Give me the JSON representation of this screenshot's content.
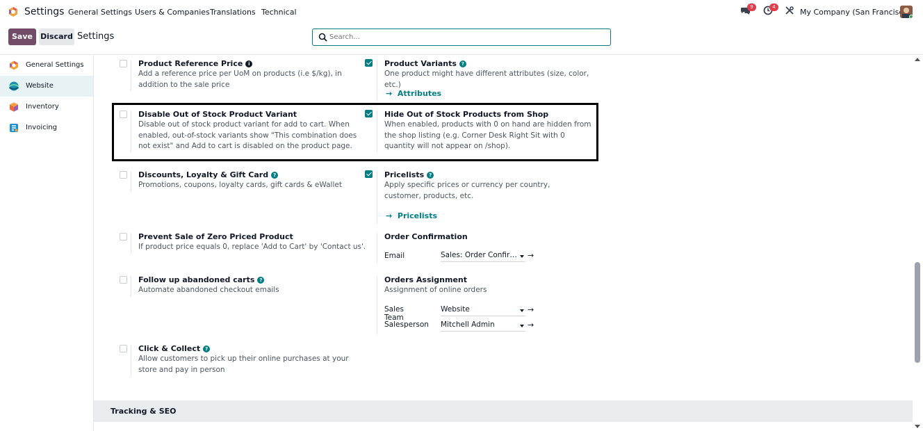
{
  "topbar": {
    "app_title": "Settings",
    "menu": [
      "General Settings",
      "Users & Companies",
      "Translations",
      "Technical"
    ],
    "messages_count": "9",
    "activities_count": "4",
    "company": "My Company (San Francisco)"
  },
  "controlbar": {
    "save_label": "Save",
    "discard_label": "Discard",
    "breadcrumb": "Settings",
    "search_placeholder": "Search..."
  },
  "sidebar": {
    "items": [
      {
        "label": "General Settings",
        "icon": "odoo-logo-icon",
        "active": false
      },
      {
        "label": "Website",
        "icon": "website-icon",
        "active": true
      },
      {
        "label": "Inventory",
        "icon": "inventory-icon",
        "active": false
      },
      {
        "label": "Invoicing",
        "icon": "invoicing-icon",
        "active": false
      }
    ]
  },
  "settings": {
    "product_reference_price": {
      "title": "Product Reference Price",
      "desc": "Add a reference price per UoM on products (i.e $/kg), in addition to the sale price",
      "checked": false
    },
    "product_variants": {
      "title": "Product Variants",
      "desc": "One product might have different attributes (size, color, etc.)",
      "link": "Attributes",
      "checked": true
    },
    "disable_oos_variant": {
      "title": "Disable Out of Stock Product Variant",
      "desc": "Disable out of stock product variant for add to cart. When enabled, out-of-stock variants show \"This combination does not exist\" and Add to cart is disabled on the product page.",
      "checked": false
    },
    "hide_oos_products": {
      "title": "Hide Out of Stock Products from Shop",
      "desc": "When enabled, products with 0 on hand are hidden from the shop listing (e.g. Corner Desk Right Sit with 0 quantity will not appear on /shop).",
      "checked": true
    },
    "discounts": {
      "title": "Discounts, Loyalty & Gift Card",
      "desc": "Promotions, coupons, loyalty cards, gift cards & eWallet",
      "checked": false
    },
    "pricelists": {
      "title": "Pricelists",
      "desc": "Apply specific prices or currency per country, customer, products, etc.",
      "link": "Pricelists",
      "checked": true
    },
    "prevent_zero_price": {
      "title": "Prevent Sale of Zero Priced Product",
      "desc": "If product price equals 0, replace 'Add to Cart' by 'Contact us'.",
      "checked": false
    },
    "order_confirmation": {
      "title": "Order Confirmation",
      "email_label": "Email",
      "email_value": "Sales: Order Confir…"
    },
    "abandoned_carts": {
      "title": "Follow up abandoned carts",
      "desc": "Automate abandoned checkout emails",
      "checked": false
    },
    "orders_assignment": {
      "title": "Orders Assignment",
      "desc": "Assignment of online orders",
      "team_label": "Sales Team",
      "team_value": "Website",
      "salesperson_label": "Salesperson",
      "salesperson_value": "Mitchell Admin"
    },
    "click_collect": {
      "title": "Click & Collect",
      "desc": "Allow customers to pick up their online purchases at your store and pay in person",
      "checked": false
    }
  },
  "section": {
    "tracking_seo": "Tracking & SEO"
  },
  "colors": {
    "brand": "#714b67",
    "accent": "#017e84",
    "badge": "#e23d4b"
  }
}
